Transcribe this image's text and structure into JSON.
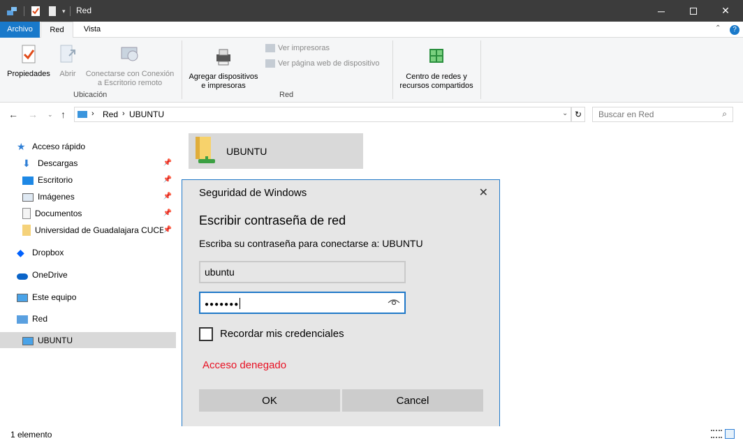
{
  "window": {
    "title": "Red"
  },
  "tabs": {
    "archivo": "Archivo",
    "red": "Red",
    "vista": "Vista"
  },
  "ribbon": {
    "propiedades": "Propiedades",
    "abrir": "Abrir",
    "conectar_line1": "Conectarse con Conexión",
    "conectar_line2": "a Escritorio remoto",
    "group_ubicacion": "Ubicación",
    "agregar_line1": "Agregar dispositivos",
    "agregar_line2": "e impresoras",
    "ver_impresoras": "Ver impresoras",
    "ver_pagina": "Ver página web de dispositivo",
    "group_red": "Red",
    "centro_line1": "Centro de redes y",
    "centro_line2": "recursos compartidos"
  },
  "address": {
    "seg1": "Red",
    "seg2": "UBUNTU"
  },
  "search": {
    "placeholder": "Buscar en Red"
  },
  "sidebar": {
    "items": [
      {
        "label": "Acceso rápido"
      },
      {
        "label": "Descargas"
      },
      {
        "label": "Escritorio"
      },
      {
        "label": "Imágenes"
      },
      {
        "label": "Documentos"
      },
      {
        "label": "Universidad de Guadalajara CUCEI"
      },
      {
        "label": "Dropbox"
      },
      {
        "label": "OneDrive"
      },
      {
        "label": "Este equipo"
      },
      {
        "label": "Red"
      },
      {
        "label": "UBUNTU"
      }
    ]
  },
  "content": {
    "tile_label": "UBUNTU"
  },
  "dialog": {
    "title": "Seguridad de Windows",
    "heading": "Escribir contraseña de red",
    "subtitle": "Escriba su contraseña para conectarse a: UBUNTU",
    "username": "ubuntu",
    "password_masked": "●●●●●●●",
    "remember": "Recordar mis credenciales",
    "error": "Acceso denegado",
    "ok": "OK",
    "cancel": "Cancel"
  },
  "status": {
    "count": "1 elemento"
  },
  "colors": {
    "accent": "#1979ca",
    "error": "#e81123",
    "titlebar": "#3c3c3c"
  }
}
